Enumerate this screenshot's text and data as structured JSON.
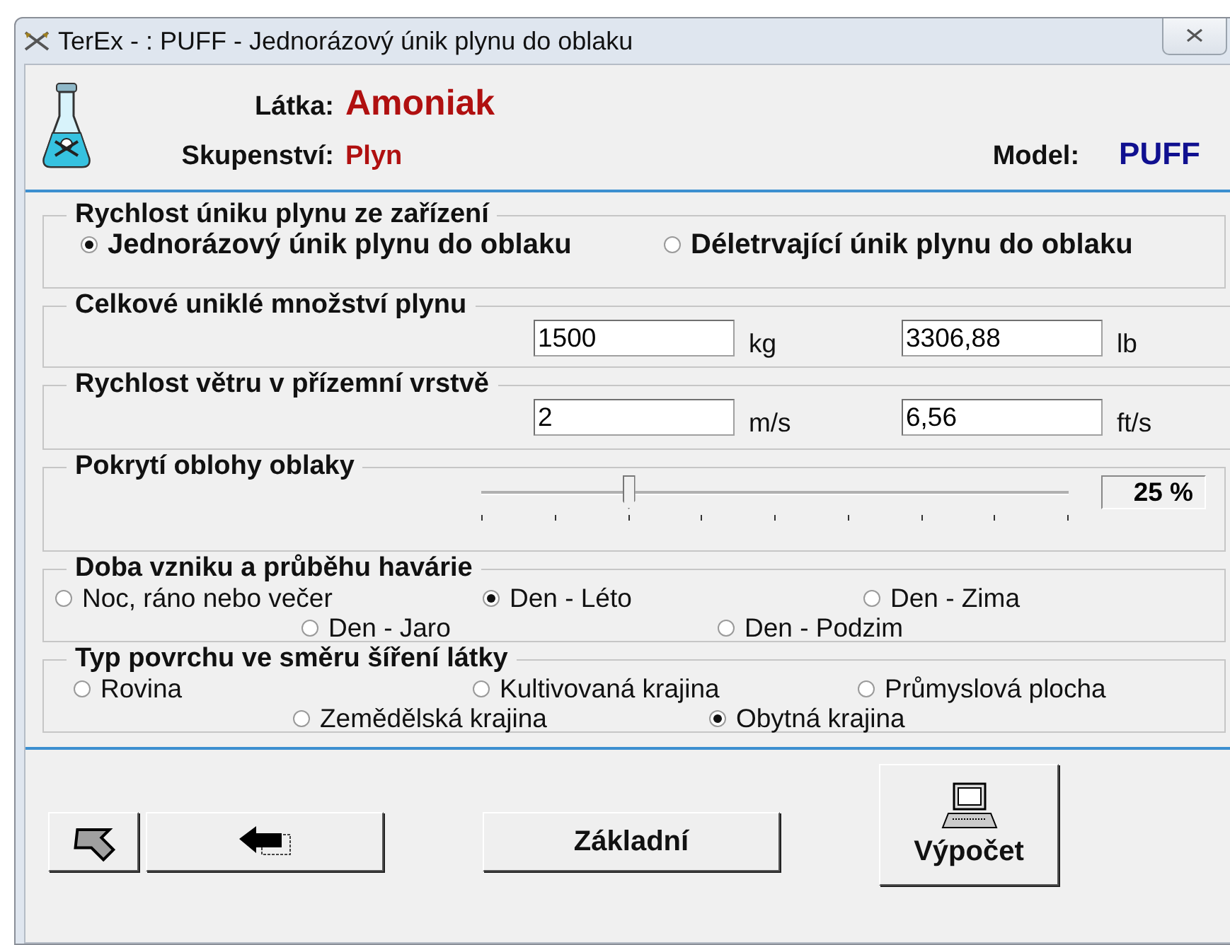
{
  "window": {
    "title": "TerEx - : PUFF - Jednorázový únik plynu do oblaku"
  },
  "header": {
    "substance_label": "Látka:",
    "substance": "Amoniak",
    "state_label": "Skupenství:",
    "state": "Plyn",
    "model_label": "Model:",
    "model": "PUFF"
  },
  "release": {
    "title": "Rychlost úniku plynu ze zařízení",
    "options": [
      {
        "label": "Jednorázový únik plynu do oblaku",
        "selected": true
      },
      {
        "label": "Déletrvající únik plynu do oblaku",
        "selected": false
      }
    ]
  },
  "amount": {
    "title": "Celkové uniklé množství plynu",
    "fields": [
      {
        "value": "1500",
        "unit": "kg"
      },
      {
        "value": "3306,88",
        "unit": "lb"
      }
    ]
  },
  "wind": {
    "title": "Rychlost větru v přízemní vrstvě",
    "fields": [
      {
        "value": "2",
        "unit": "m/s"
      },
      {
        "value": "6,56",
        "unit": "ft/s"
      }
    ]
  },
  "cloud": {
    "title": "Pokrytí oblohy oblaky",
    "level": 0.25,
    "reading": "25 %"
  },
  "time": {
    "title": "Doba vzniku a průběhu havárie",
    "options": [
      {
        "label": "Noc, ráno nebo večer",
        "selected": false
      },
      {
        "label": "Den - Léto",
        "selected": true
      },
      {
        "label": "Den - Zima",
        "selected": false
      },
      {
        "label": "Den - Jaro",
        "selected": false
      },
      {
        "label": "Den - Podzim",
        "selected": false
      }
    ]
  },
  "surface": {
    "title": "Typ povrchu ve směru šíření látky",
    "options": [
      {
        "label": "Rovina",
        "selected": false
      },
      {
        "label": "Kultivovaná krajina",
        "selected": false
      },
      {
        "label": "Průmyslová plocha",
        "selected": false
      },
      {
        "label": "Zemědělská krajina",
        "selected": false
      },
      {
        "label": "Obytná krajina",
        "selected": true
      }
    ]
  },
  "buttons": [
    {
      "kind": "arrow"
    },
    {
      "kind": "back"
    },
    {
      "kind": "text",
      "label": "Základní"
    },
    {
      "kind": "compute",
      "label": "Výpočet"
    }
  ]
}
